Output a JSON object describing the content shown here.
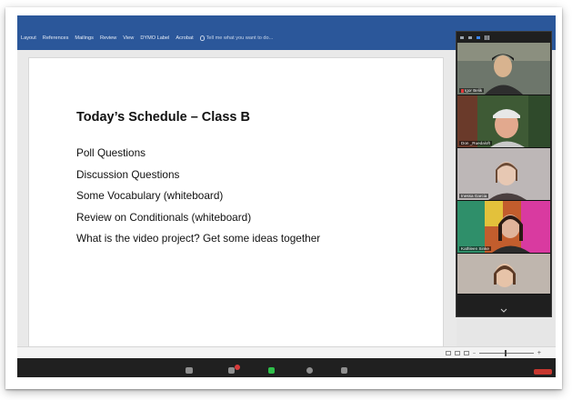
{
  "window": {
    "title": ""
  },
  "ribbon": {
    "tabs": [
      "Layout",
      "References",
      "Mailings",
      "Review",
      "View",
      "DYMO Label",
      "Acrobat"
    ],
    "tell_me_placeholder": "Tell me what you want to do..."
  },
  "document": {
    "title": "Today’s Schedule – Class B",
    "items": [
      "Poll Questions",
      "Discussion Questions",
      "Some Vocabulary (whiteboard)",
      "Review on Conditionals (whiteboard)",
      "What is the video project?  Get some ideas together"
    ]
  },
  "participants": [
    {
      "name": "Igor Belik",
      "muted": true,
      "bg": "#6f7a6a"
    },
    {
      "name": "Don _Ruedaloft",
      "muted": false,
      "bg": "#3e5a35"
    },
    {
      "name": "Inessa Garcia",
      "muted": false,
      "bg": "#b9b3b3"
    },
    {
      "name": "Kathleen Sinke",
      "muted": false,
      "bg": "#c25d2d"
    },
    {
      "name": "",
      "muted": false,
      "bg": "#bfb6ae"
    }
  ],
  "colors": {
    "ribbon": "#2b579a",
    "panel": "#1f1f1f",
    "taskbar": "#202020"
  }
}
